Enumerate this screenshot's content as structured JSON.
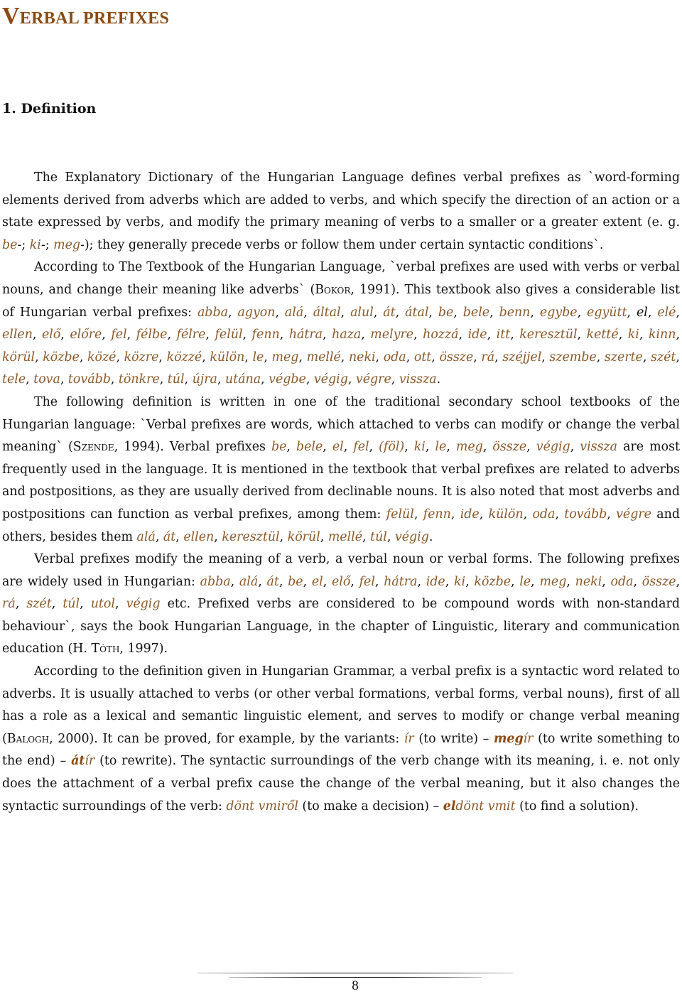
{
  "document": {
    "title_first_letter": "V",
    "title_rest": "ERBAL PREFIXES",
    "section_heading": "1. Definition",
    "paragraphs": [
      [
        {
          "t": "The Explanatory Dictionary of the Hungarian Language defines verbal prefixes as `word-forming elements derived from adverbs which are added to verbs, and which specify the direction of an action or a state expressed by verbs, and modify the primary meaning of verbs to a smaller or a greater extent (e. g. "
        },
        {
          "t": "be",
          "s": "hu"
        },
        {
          "t": "-; "
        },
        {
          "t": "ki",
          "s": "hu"
        },
        {
          "t": "-; "
        },
        {
          "t": "meg",
          "s": "hu"
        },
        {
          "t": "-); they generally precede verbs or follow them under certain syntactic conditions`."
        }
      ],
      [
        {
          "t": "According to The Textbook of the Hungarian Language, `verbal prefixes are used with verbs or verbal nouns, and change their meaning like adverbs` ("
        },
        {
          "t": "Bokor",
          "s": "sc"
        },
        {
          "t": ", 1991). This textbook also gives a considerable list of Hungarian verbal prefixes: "
        },
        {
          "t": "abba",
          "s": "hu"
        },
        {
          "t": ", "
        },
        {
          "t": "agyon",
          "s": "hu"
        },
        {
          "t": ", "
        },
        {
          "t": "alá",
          "s": "hu"
        },
        {
          "t": ", "
        },
        {
          "t": "által",
          "s": "hu"
        },
        {
          "t": ", "
        },
        {
          "t": "alul",
          "s": "hu"
        },
        {
          "t": ", "
        },
        {
          "t": "át",
          "s": "hu"
        },
        {
          "t": ", "
        },
        {
          "t": "átal",
          "s": "hu"
        },
        {
          "t": ", "
        },
        {
          "t": "be",
          "s": "hu"
        },
        {
          "t": ", "
        },
        {
          "t": "bele",
          "s": "hu"
        },
        {
          "t": ", "
        },
        {
          "t": "benn",
          "s": "hu"
        },
        {
          "t": ", "
        },
        {
          "t": "egybe",
          "s": "hu"
        },
        {
          "t": ", "
        },
        {
          "t": "együtt",
          "s": "hu"
        },
        {
          "t": ", "
        },
        {
          "t": "el",
          "s": "hu-plain"
        },
        {
          "t": ", "
        },
        {
          "t": "elé",
          "s": "hu"
        },
        {
          "t": ", "
        },
        {
          "t": "ellen",
          "s": "hu"
        },
        {
          "t": ", "
        },
        {
          "t": "elő",
          "s": "hu"
        },
        {
          "t": ", "
        },
        {
          "t": "előre",
          "s": "hu"
        },
        {
          "t": ", "
        },
        {
          "t": "fel",
          "s": "hu"
        },
        {
          "t": ", "
        },
        {
          "t": "félbe",
          "s": "hu"
        },
        {
          "t": ", "
        },
        {
          "t": "félre",
          "s": "hu"
        },
        {
          "t": ", "
        },
        {
          "t": "felül",
          "s": "hu"
        },
        {
          "t": ", "
        },
        {
          "t": "fenn",
          "s": "hu"
        },
        {
          "t": ", "
        },
        {
          "t": "hátra",
          "s": "hu"
        },
        {
          "t": ", "
        },
        {
          "t": "haza",
          "s": "hu"
        },
        {
          "t": ", "
        },
        {
          "t": "melyre",
          "s": "hu"
        },
        {
          "t": ", "
        },
        {
          "t": "hozzá",
          "s": "hu"
        },
        {
          "t": ", "
        },
        {
          "t": "ide",
          "s": "hu"
        },
        {
          "t": ", "
        },
        {
          "t": "itt",
          "s": "hu"
        },
        {
          "t": ", "
        },
        {
          "t": "keresztül",
          "s": "hu"
        },
        {
          "t": ", "
        },
        {
          "t": "ketté",
          "s": "hu"
        },
        {
          "t": ", "
        },
        {
          "t": "ki",
          "s": "hu"
        },
        {
          "t": ", "
        },
        {
          "t": "kinn",
          "s": "hu"
        },
        {
          "t": ", "
        },
        {
          "t": "körül",
          "s": "hu"
        },
        {
          "t": ", "
        },
        {
          "t": "közbe",
          "s": "hu"
        },
        {
          "t": ", "
        },
        {
          "t": "közé",
          "s": "hu"
        },
        {
          "t": ", "
        },
        {
          "t": "közre",
          "s": "hu"
        },
        {
          "t": ", "
        },
        {
          "t": "közzé",
          "s": "hu"
        },
        {
          "t": ", "
        },
        {
          "t": "külön",
          "s": "hu"
        },
        {
          "t": ", "
        },
        {
          "t": "le",
          "s": "hu"
        },
        {
          "t": ", "
        },
        {
          "t": "meg",
          "s": "hu"
        },
        {
          "t": ", "
        },
        {
          "t": "mellé",
          "s": "hu"
        },
        {
          "t": ", "
        },
        {
          "t": "neki",
          "s": "hu"
        },
        {
          "t": ", "
        },
        {
          "t": "oda",
          "s": "hu"
        },
        {
          "t": ", "
        },
        {
          "t": "ott",
          "s": "hu"
        },
        {
          "t": ", "
        },
        {
          "t": "össze",
          "s": "hu"
        },
        {
          "t": ", "
        },
        {
          "t": "rá",
          "s": "hu"
        },
        {
          "t": ", "
        },
        {
          "t": "széjjel",
          "s": "hu"
        },
        {
          "t": ", "
        },
        {
          "t": "szembe",
          "s": "hu"
        },
        {
          "t": ", "
        },
        {
          "t": "szerte",
          "s": "hu"
        },
        {
          "t": ", "
        },
        {
          "t": "szét",
          "s": "hu"
        },
        {
          "t": ", "
        },
        {
          "t": "tele",
          "s": "hu"
        },
        {
          "t": ", "
        },
        {
          "t": "tova",
          "s": "hu"
        },
        {
          "t": ", "
        },
        {
          "t": "tovább",
          "s": "hu"
        },
        {
          "t": ", "
        },
        {
          "t": "tönkre",
          "s": "hu"
        },
        {
          "t": ", "
        },
        {
          "t": "túl",
          "s": "hu"
        },
        {
          "t": ", "
        },
        {
          "t": "újra",
          "s": "hu"
        },
        {
          "t": ", "
        },
        {
          "t": "utána",
          "s": "hu"
        },
        {
          "t": ", "
        },
        {
          "t": "végbe",
          "s": "hu"
        },
        {
          "t": ", "
        },
        {
          "t": "végig",
          "s": "hu"
        },
        {
          "t": ", "
        },
        {
          "t": "végre",
          "s": "hu"
        },
        {
          "t": ", "
        },
        {
          "t": "vissza",
          "s": "hu"
        },
        {
          "t": "."
        }
      ],
      [
        {
          "t": "The following definition is written in one of the traditional secondary school textbooks of the Hungarian language: `Verbal prefixes are words, which attached to verbs can modify or change the verbal meaning` ("
        },
        {
          "t": "Szende",
          "s": "sc"
        },
        {
          "t": ", 1994). Verbal prefixes "
        },
        {
          "t": "be",
          "s": "hu"
        },
        {
          "t": ", "
        },
        {
          "t": "bele",
          "s": "hu"
        },
        {
          "t": ", "
        },
        {
          "t": "el",
          "s": "hu"
        },
        {
          "t": ", "
        },
        {
          "t": "fel",
          "s": "hu"
        },
        {
          "t": ", "
        },
        {
          "t": "(föl)",
          "s": "hu"
        },
        {
          "t": ", "
        },
        {
          "t": "ki",
          "s": "hu"
        },
        {
          "t": ", "
        },
        {
          "t": "le",
          "s": "hu"
        },
        {
          "t": ", "
        },
        {
          "t": "meg",
          "s": "hu"
        },
        {
          "t": ", "
        },
        {
          "t": "össze",
          "s": "hu"
        },
        {
          "t": ", "
        },
        {
          "t": "végig",
          "s": "hu"
        },
        {
          "t": ", "
        },
        {
          "t": "vissza",
          "s": "hu"
        },
        {
          "t": " are most frequently used in the language. It is mentioned in the textbook that verbal prefixes are related to adverbs and postpositions, as they are usually derived from declinable nouns. It is also noted that most adverbs and postpositions can function as verbal prefixes, among them: "
        },
        {
          "t": "felül",
          "s": "hu"
        },
        {
          "t": ", "
        },
        {
          "t": "fenn",
          "s": "hu"
        },
        {
          "t": ", "
        },
        {
          "t": "ide",
          "s": "hu"
        },
        {
          "t": ", "
        },
        {
          "t": "külön",
          "s": "hu"
        },
        {
          "t": ", "
        },
        {
          "t": "oda",
          "s": "hu"
        },
        {
          "t": ", "
        },
        {
          "t": "tovább",
          "s": "hu"
        },
        {
          "t": ", "
        },
        {
          "t": "végre",
          "s": "hu"
        },
        {
          "t": " and others, besides them "
        },
        {
          "t": "alá",
          "s": "hu"
        },
        {
          "t": ", "
        },
        {
          "t": "át",
          "s": "hu"
        },
        {
          "t": ", "
        },
        {
          "t": "ellen",
          "s": "hu"
        },
        {
          "t": ", "
        },
        {
          "t": "keresztül",
          "s": "hu"
        },
        {
          "t": ", "
        },
        {
          "t": "körül",
          "s": "hu"
        },
        {
          "t": ", "
        },
        {
          "t": "mellé",
          "s": "hu"
        },
        {
          "t": ", "
        },
        {
          "t": "túl",
          "s": "hu"
        },
        {
          "t": ", "
        },
        {
          "t": "végig",
          "s": "hu"
        },
        {
          "t": "."
        }
      ],
      [
        {
          "t": "Verbal prefixes modify the meaning of a verb, a verbal noun or verbal forms. The following prefixes are widely used in Hungarian: "
        },
        {
          "t": "abba",
          "s": "hu"
        },
        {
          "t": ", "
        },
        {
          "t": "alá",
          "s": "hu"
        },
        {
          "t": ", "
        },
        {
          "t": "át",
          "s": "hu"
        },
        {
          "t": ", "
        },
        {
          "t": "be",
          "s": "hu"
        },
        {
          "t": ", "
        },
        {
          "t": "el",
          "s": "hu"
        },
        {
          "t": ", "
        },
        {
          "t": "elő",
          "s": "hu"
        },
        {
          "t": ", "
        },
        {
          "t": "fel",
          "s": "hu"
        },
        {
          "t": ", "
        },
        {
          "t": "hátra",
          "s": "hu"
        },
        {
          "t": ", "
        },
        {
          "t": "ide",
          "s": "hu"
        },
        {
          "t": ", "
        },
        {
          "t": "ki",
          "s": "hu"
        },
        {
          "t": ", "
        },
        {
          "t": "közbe",
          "s": "hu"
        },
        {
          "t": ", "
        },
        {
          "t": "le",
          "s": "hu"
        },
        {
          "t": ", "
        },
        {
          "t": "meg",
          "s": "hu"
        },
        {
          "t": ", "
        },
        {
          "t": "neki",
          "s": "hu"
        },
        {
          "t": ", "
        },
        {
          "t": "oda",
          "s": "hu"
        },
        {
          "t": ", "
        },
        {
          "t": "össze",
          "s": "hu"
        },
        {
          "t": ", "
        },
        {
          "t": "rá",
          "s": "hu"
        },
        {
          "t": ", "
        },
        {
          "t": "szét",
          "s": "hu"
        },
        {
          "t": ", "
        },
        {
          "t": "túl",
          "s": "hu"
        },
        {
          "t": ", "
        },
        {
          "t": "utol",
          "s": "hu"
        },
        {
          "t": ", "
        },
        {
          "t": "végig",
          "s": "hu"
        },
        {
          "t": " etc. Prefixed verbs are considered to be compound words with non-standard behaviour`, says the book Hungarian Language, in the chapter of Linguistic, literary and communication education (H. "
        },
        {
          "t": "Tóth",
          "s": "sc"
        },
        {
          "t": ", 1997)."
        }
      ],
      [
        {
          "t": "According to the definition given in Hungarian Grammar, a verbal prefix is a syntactic word related to adverbs. It is usually attached to verbs (or other verbal formations, verbal forms, verbal nouns), first of all has a role as a lexical and semantic linguistic element, and serves to modify or change verbal meaning ("
        },
        {
          "t": "Balogh",
          "s": "sc"
        },
        {
          "t": ", 2000). It can be proved, for example, by the variants: "
        },
        {
          "t": "ír",
          "s": "hu"
        },
        {
          "t": " (to write) – "
        },
        {
          "t": "meg",
          "s": "hu-bold"
        },
        {
          "t": "ír",
          "s": "hu"
        },
        {
          "t": " (to write something to the end) – "
        },
        {
          "t": "át",
          "s": "hu-bold"
        },
        {
          "t": "ír",
          "s": "hu"
        },
        {
          "t": " (to rewrite). The syntactic surroundings of the verb change with its meaning, i. e. not only does the attachment of a verbal prefix cause the change of the verbal meaning, but it also changes the syntactic surroundings of the verb: "
        },
        {
          "t": "dönt vmiről",
          "s": "hu"
        },
        {
          "t": " (to make a decision) – "
        },
        {
          "t": "el",
          "s": "hu-bold"
        },
        {
          "t": "dönt vmit",
          "s": "hu"
        },
        {
          "t": " (to find a solution)."
        }
      ]
    ],
    "page_number": "8"
  },
  "colors": {
    "title": "#8b4a12",
    "hungarian_word": "#8b5a2b",
    "text": "#111111"
  }
}
